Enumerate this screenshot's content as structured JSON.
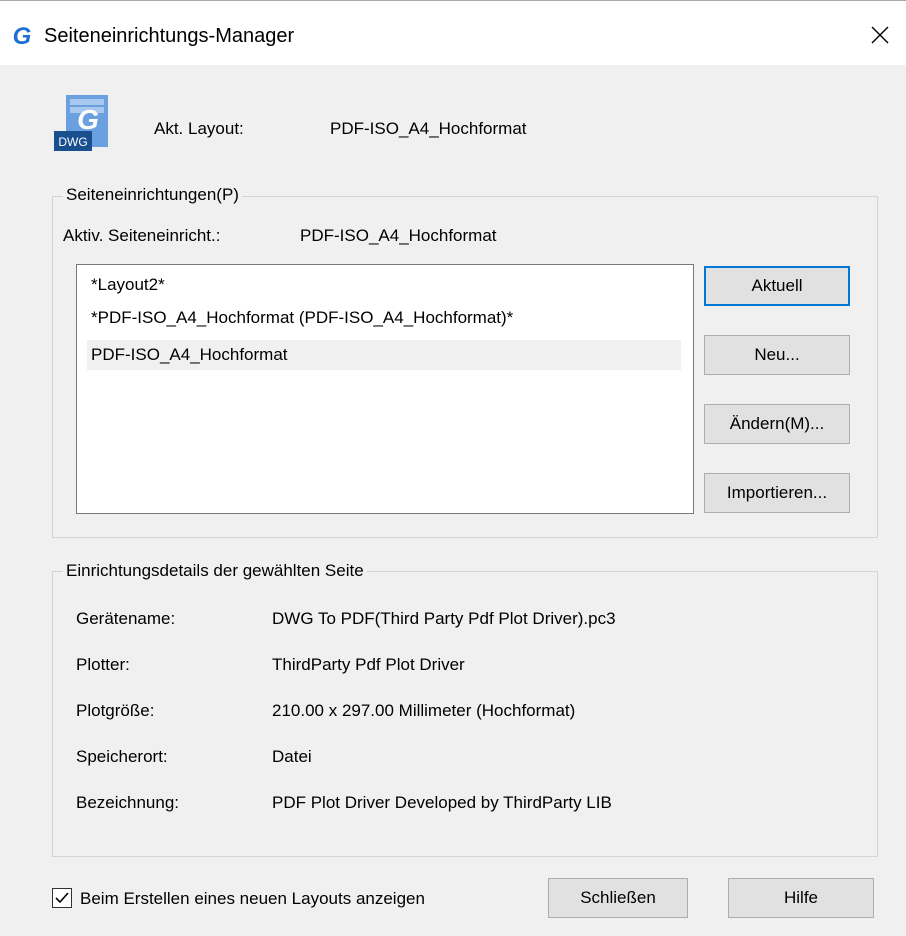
{
  "window": {
    "title": "Seiteneinrichtungs-Manager",
    "app_icon_letter": "G",
    "close_glyph": "✕"
  },
  "icons": {
    "app": "gstarcad-icon",
    "close": "close-icon",
    "dwg_file": "dwg-file-icon",
    "dwg_text": "DWG",
    "dwg_letter": "G",
    "checkbox": "checkmark-icon"
  },
  "layout": {
    "label": "Akt. Layout:",
    "value": "PDF-ISO_A4_Hochformat"
  },
  "page_setups": {
    "caption": "Seiteneinrichtungen(P)",
    "active_label": "Aktiv. Seiteneinricht.:",
    "active_value": "PDF-ISO_A4_Hochformat",
    "items": [
      "*Layout2*",
      "*PDF-ISO_A4_Hochformat (PDF-ISO_A4_Hochformat)*",
      "PDF-ISO_A4_Hochformat"
    ],
    "selected_index": 2
  },
  "buttons": {
    "set_current": "Aktuell",
    "new": "Neu...",
    "modify": "Ändern(M)...",
    "import": "Importieren...",
    "close": "Schließen",
    "help": "Hilfe"
  },
  "details": {
    "caption": "Einrichtungsdetails der gewählten Seite",
    "rows": [
      {
        "label": "Gerätename:",
        "value": "DWG To PDF(Third Party Pdf Plot Driver).pc3"
      },
      {
        "label": "Plotter:",
        "value": "ThirdParty Pdf Plot Driver"
      },
      {
        "label": "Plotgröße:",
        "value": "210.00 x 297.00 Millimeter (Hochformat)"
      },
      {
        "label": "Speicherort:",
        "value": "Datei"
      },
      {
        "label": "Bezeichnung:",
        "value": "PDF Plot Driver Developed by ThirdParty LIB"
      }
    ]
  },
  "options": {
    "show_on_new_layout_label": "Beim Erstellen eines neuen Layouts anzeigen",
    "show_on_new_layout_checked": true
  },
  "colors": {
    "accent": "#0078d7",
    "app_icon": "#1e6fd0",
    "dwg_dark": "#1a4f8f",
    "dwg_light": "#6a9fe0"
  }
}
